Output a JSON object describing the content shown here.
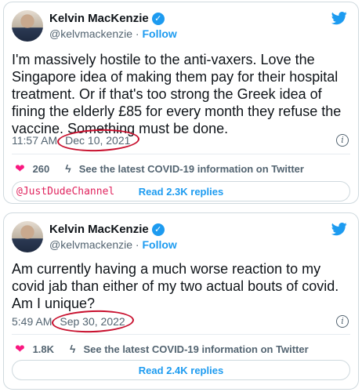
{
  "colors": {
    "accent": "#1d9bf0",
    "heart": "#f91880",
    "circle_annotation": "#c8102e",
    "watermark": "#e0245e"
  },
  "tweets": [
    {
      "author": {
        "name": "Kelvin MacKenzie",
        "handle": "@kelvmackenzie",
        "separator": "·",
        "follow_label": "Follow"
      },
      "text": "I'm massively hostile to the anti-vaxers. Love the Singapore idea of making them pay for their hospital treatment. Or if that's too strong the Greek idea of fining the elderly £85 for every month they refuse the vaccine. Something must be done.",
      "time": "11:57 AM",
      "date": "Dec 10, 2021",
      "likes": "260",
      "covid_link": "See the latest COVID-19 information on Twitter",
      "replies_label": "Read 2.3K replies",
      "icons": [
        "avatar",
        "verified-badge-icon",
        "twitter-bird-icon",
        "info-icon",
        "heart-icon",
        "lightning-icon"
      ]
    },
    {
      "author": {
        "name": "Kelvin MacKenzie",
        "handle": "@kelvmackenzie",
        "separator": "·",
        "follow_label": "Follow"
      },
      "text": "Am currently having a much worse reaction to my covid jab than either of my two actual bouts of covid. Am I unique?",
      "time": "5:49 AM",
      "date": "Sep 30, 2022",
      "likes": "1.8K",
      "covid_link": "See the latest COVID-19 information on Twitter",
      "replies_label": "Read 2.4K replies",
      "icons": [
        "avatar",
        "verified-badge-icon",
        "twitter-bird-icon",
        "info-icon",
        "heart-icon",
        "lightning-icon"
      ]
    }
  ],
  "watermark": "@JustDudeChannel"
}
